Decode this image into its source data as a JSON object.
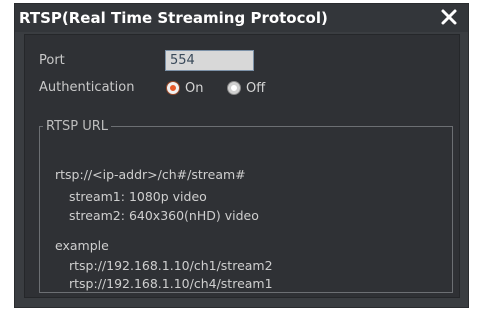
{
  "dialog": {
    "title": "RTSP(Real Time Streaming Protocol)",
    "close_icon": "close-icon"
  },
  "form": {
    "port_label": "Port",
    "port_value": "554",
    "auth_label": "Authentication",
    "auth_on_label": "On",
    "auth_off_label": "Off",
    "auth_selected": "On"
  },
  "rtsp_url": {
    "legend": "RTSP URL",
    "format": "rtsp://<ip-addr>/ch#/stream#",
    "streams": [
      "stream1: 1080p video",
      "stream2: 640x360(nHD) video"
    ],
    "example_label": "example",
    "examples": [
      "rtsp://192.168.1.10/ch1/stream2",
      "rtsp://192.168.1.10/ch4/stream1"
    ]
  },
  "colors": {
    "accent": "#e85a2a",
    "dialog_bg": "#3a3d41",
    "panel_bg": "#2f3135"
  }
}
